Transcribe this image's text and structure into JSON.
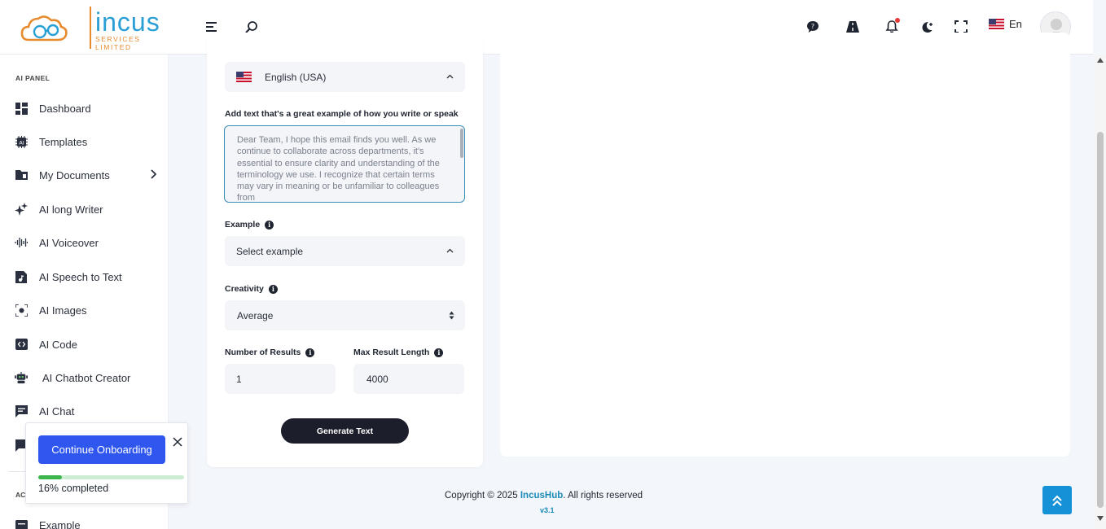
{
  "brand": {
    "name": "incus",
    "tagline": "SERVICES LIMITED"
  },
  "header": {
    "language_label": "En",
    "icons": [
      "menu-icon",
      "search-icon",
      "chat-help-icon",
      "road-icon",
      "bell-icon",
      "dark-mode-icon",
      "fullscreen-icon"
    ]
  },
  "sidebar": {
    "section_title": "AI PANEL",
    "items": [
      {
        "label": "Dashboard",
        "icon": "dashboard-icon"
      },
      {
        "label": "Templates",
        "icon": "templates-icon"
      },
      {
        "label": "My Documents",
        "icon": "folder-icon"
      },
      {
        "label": "AI long Writer",
        "icon": "sparkle-icon"
      },
      {
        "label": "AI Voiceover",
        "icon": "waveform-icon"
      },
      {
        "label": "AI Speech to Text",
        "icon": "audio-file-icon"
      },
      {
        "label": "AI Images",
        "icon": "image-scan-icon"
      },
      {
        "label": "AI Code",
        "icon": "code-icon"
      },
      {
        "label": "AI Chatbot Creator",
        "icon": "chatbot-icon"
      },
      {
        "label": "AI Chat",
        "icon": "chat-icon"
      },
      {
        "label": "Example",
        "icon": "example-icon"
      }
    ],
    "subsection_title": "AC"
  },
  "form": {
    "language_value": "English (USA)",
    "sample_text_label": "Add text that's a great example of how you write or speak",
    "sample_text_value": "Dear Team,  I hope this email finds you well. As we continue to collaborate across departments, it's essential to ensure clarity and understanding of the terminology we use. I recognize that certain terms may vary in meaning or be unfamiliar to colleagues from",
    "example_label": "Example",
    "example_value": "Select example",
    "creativity_label": "Creativity",
    "creativity_value": "Average",
    "num_results_label": "Number of Results",
    "num_results_value": "1",
    "max_length_label": "Max Result Length",
    "max_length_value": "4000",
    "generate_label": "Generate Text"
  },
  "footer": {
    "copyright_prefix": "Copyright © 2025 ",
    "brand": "IncusHub",
    "copyright_suffix": ". All rights reserved",
    "version": "v3.1"
  },
  "onboarding": {
    "button_label": "Continue Onboarding",
    "progress_percent": 16,
    "progress_text": "16% completed"
  },
  "colors": {
    "accent": "#2f56ee",
    "brand_blue": "#2a9fd6",
    "brand_orange": "#e88a2e",
    "progress_green": "#3cb54a",
    "dark_button": "#1c1f2b"
  }
}
